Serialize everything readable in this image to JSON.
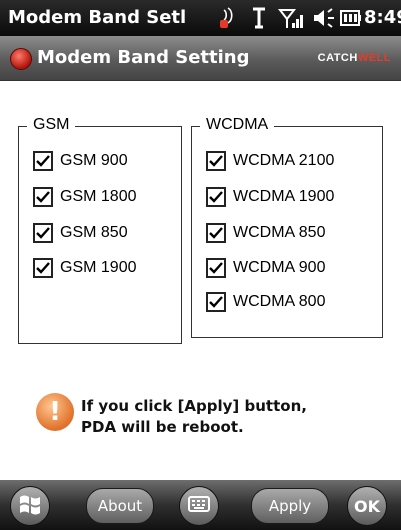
{
  "status_bar": {
    "app_title": "Modem Band Setl",
    "time": "8:49"
  },
  "header": {
    "title": "Modem Band Setting",
    "brand_part1": "CATCH",
    "brand_part2": "WELL",
    "brand_accent_color": "#e63a2a"
  },
  "gsm": {
    "legend": "GSM",
    "items": [
      {
        "label": "GSM 900",
        "checked": true
      },
      {
        "label": "GSM 1800",
        "checked": true
      },
      {
        "label": "GSM 850",
        "checked": true
      },
      {
        "label": "GSM 1900",
        "checked": true
      }
    ]
  },
  "wcdma": {
    "legend": "WCDMA",
    "items": [
      {
        "label": "WCDMA 2100",
        "checked": true
      },
      {
        "label": "WCDMA 1900",
        "checked": true
      },
      {
        "label": "WCDMA 850",
        "checked": true
      },
      {
        "label": "WCDMA 900",
        "checked": true
      },
      {
        "label": "WCDMA 800",
        "checked": true
      }
    ]
  },
  "warning": {
    "icon": "!",
    "line1": "If you click [Apply] button,",
    "line2": "PDA will be reboot."
  },
  "bottom_bar": {
    "start_icon": "windows-logo-icon",
    "about": "About",
    "keyboard_icon": "keyboard-icon",
    "apply": "Apply",
    "ok": "OK"
  }
}
